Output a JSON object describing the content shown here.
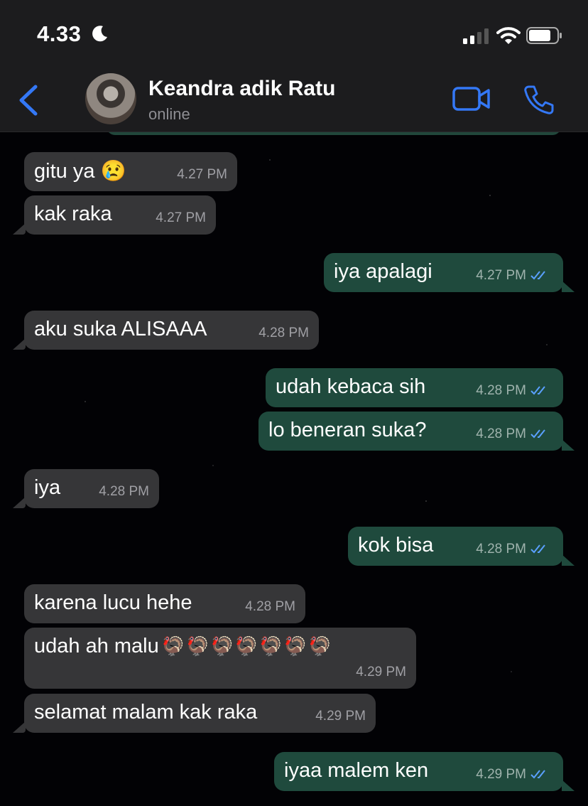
{
  "status_bar": {
    "time": "4.33",
    "moon_icon": "moon-icon",
    "signal_icon": "cellular-signal-icon",
    "wifi_icon": "wifi-icon",
    "battery_icon": "battery-icon"
  },
  "header": {
    "contact_name": "Keandra adik Ratu",
    "status": "online",
    "back_icon": "chevron-left-icon",
    "video_icon": "video-camera-icon",
    "phone_icon": "phone-icon"
  },
  "colors": {
    "incoming_bubble": "#363638",
    "outgoing_bubble": "#1f4a3d",
    "accent": "#3478f6",
    "read_ticks": "#5aa0ff"
  },
  "messages": [
    {
      "dir": "in",
      "text": "gitu ya 😢",
      "time": "4.27 PM"
    },
    {
      "dir": "in",
      "text": "kak raka",
      "time": "4.27 PM"
    },
    {
      "dir": "out",
      "text": "iya apalagi",
      "time": "4.27 PM",
      "status": "read"
    },
    {
      "dir": "in",
      "text": "aku suka ALISAAA",
      "time": "4.28 PM"
    },
    {
      "dir": "out",
      "text": "udah kebaca sih",
      "time": "4.28 PM",
      "status": "read"
    },
    {
      "dir": "out",
      "text": "lo beneran suka?",
      "time": "4.28 PM",
      "status": "read"
    },
    {
      "dir": "in",
      "text": "iya",
      "time": "4.28 PM"
    },
    {
      "dir": "out",
      "text": "kok bisa",
      "time": "4.28 PM",
      "status": "read"
    },
    {
      "dir": "in",
      "text": "karena lucu hehe",
      "time": "4.28 PM"
    },
    {
      "dir": "in",
      "text": "udah ah malu",
      "emoji": "🦃🦃🦃🦃🦃🦃🦃",
      "time": "4.29 PM"
    },
    {
      "dir": "in",
      "text": "selamat malam kak raka",
      "time": "4.29 PM"
    },
    {
      "dir": "out",
      "text": "iyaa malem ken",
      "time": "4.29 PM",
      "status": "read"
    }
  ]
}
